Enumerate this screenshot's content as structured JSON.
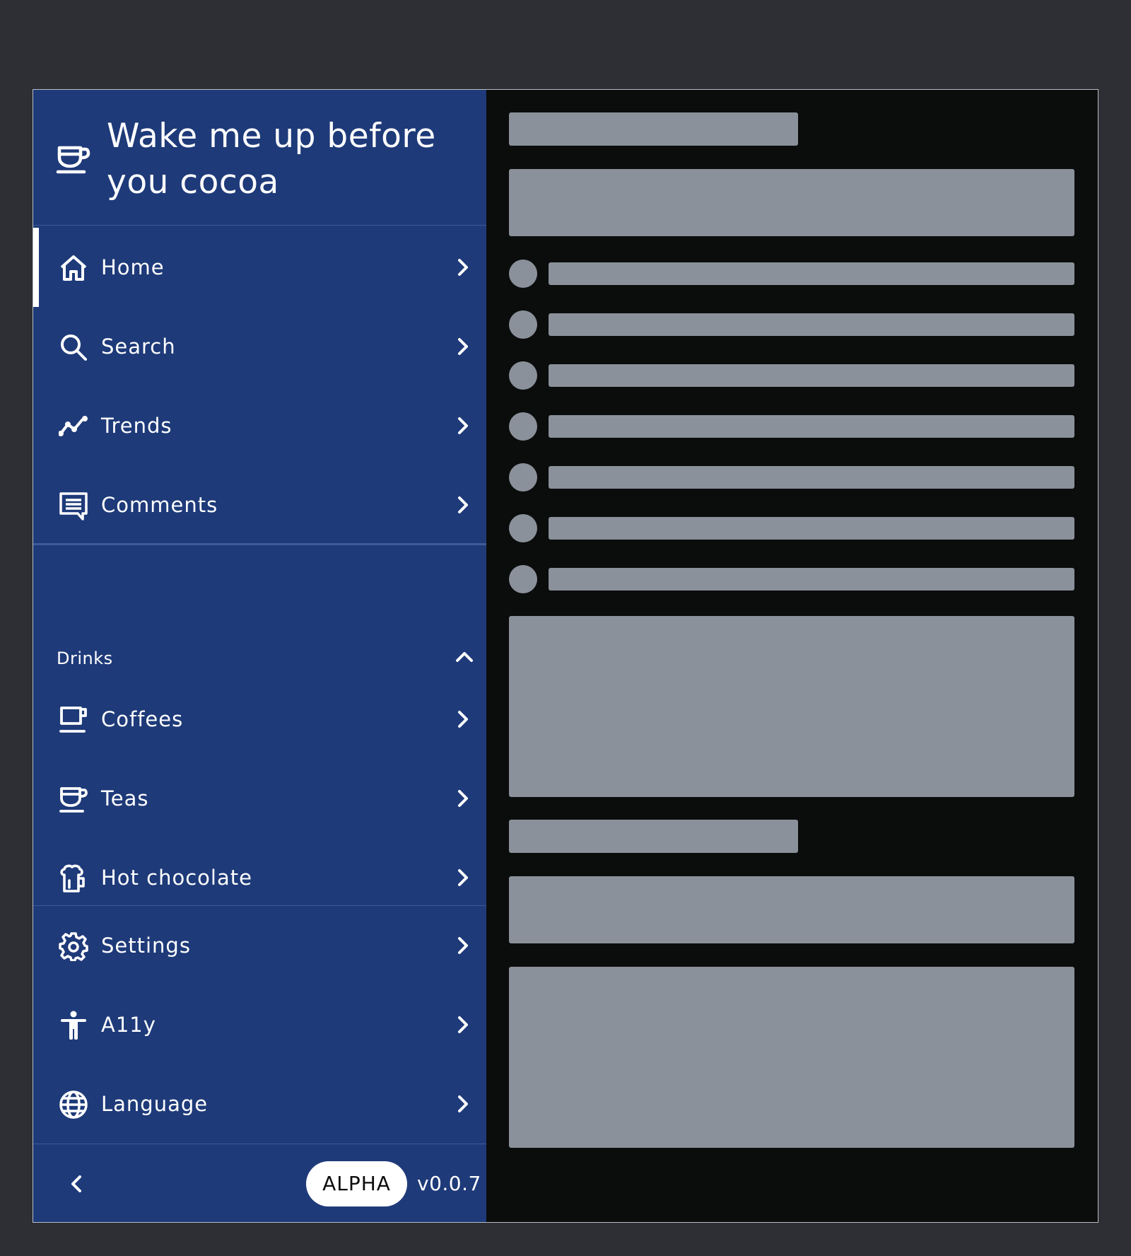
{
  "app": {
    "title": "Wake me up before you cocoa",
    "brand_icon": "cup-icon"
  },
  "nav": {
    "main": [
      {
        "label": "Home",
        "icon": "home-icon",
        "active": true
      },
      {
        "label": "Search",
        "icon": "search-icon"
      },
      {
        "label": "Trends",
        "icon": "trends-icon"
      },
      {
        "label": "Comments",
        "icon": "comments-icon"
      }
    ],
    "group": {
      "label": "Drinks",
      "expanded": true,
      "items": [
        {
          "label": "Coffees",
          "icon": "coffee-icon"
        },
        {
          "label": "Teas",
          "icon": "tea-icon"
        },
        {
          "label": "Hot chocolate",
          "icon": "hot-chocolate-icon"
        }
      ]
    },
    "bottom": [
      {
        "label": "Settings",
        "icon": "gear-icon"
      },
      {
        "label": "A11y",
        "icon": "accessibility-icon"
      },
      {
        "label": "Language",
        "icon": "globe-icon"
      }
    ]
  },
  "footer": {
    "badge": "ALPHA",
    "version": "v0.0.7"
  },
  "colors": {
    "page_bg": "#2d2f34",
    "sidebar_bg": "#1e3a79",
    "divider": "#3f5a97",
    "content_bg": "#0b0c0c",
    "skeleton": "#8a919a",
    "text": "#ffffff"
  }
}
